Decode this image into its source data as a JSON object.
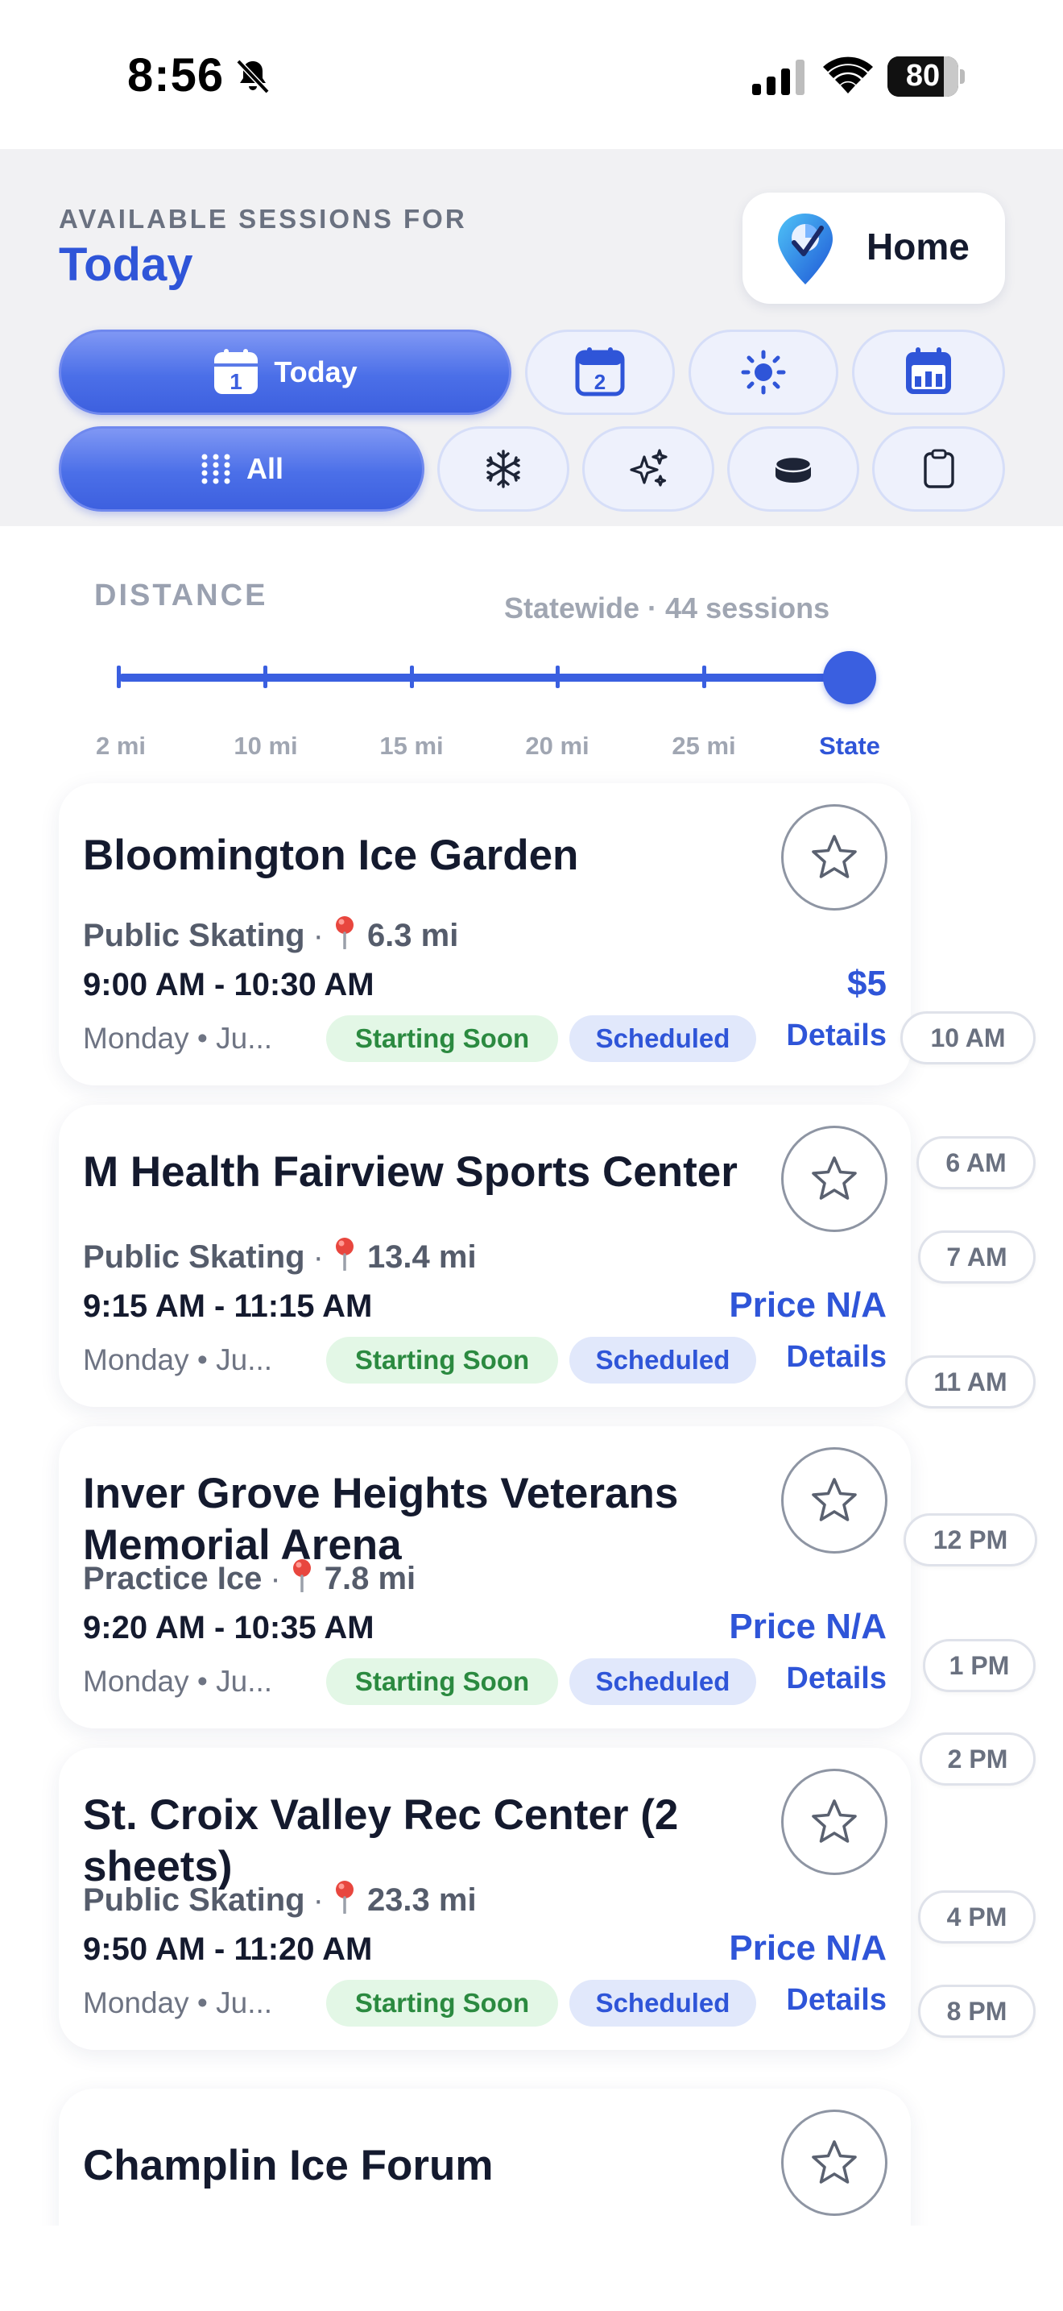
{
  "status_bar": {
    "time": "8:56",
    "battery": "80",
    "battery_level": 0.8
  },
  "header": {
    "label": "AVAILABLE SESSIONS FOR",
    "day": "Today",
    "home_button": "Home",
    "date_pills": {
      "today_label": "Today",
      "calendar_icon_day": "2"
    },
    "type_pills": {
      "all_label": "All"
    }
  },
  "icons": {
    "today": "calendar-today-icon",
    "tomorrow": "calendar-icon",
    "sun": "sun-icon",
    "week": "calendar-week-icon",
    "grid": "grid-icon",
    "snowflake": "snowflake-icon",
    "sparkles": "sparkles-icon",
    "puck": "hockey-puck-icon",
    "clipboard": "clipboard-icon",
    "star": "star-icon",
    "pin": "pin-icon"
  },
  "colors": {
    "accent": "#2f55d8",
    "starting_soon": "#2b8a40",
    "scheduled": "#2f55d8"
  },
  "distance": {
    "label": "DISTANCE",
    "summary": "Statewide · 44 sessions",
    "options": [
      "2 mi",
      "10 mi",
      "15 mi",
      "20 mi",
      "25 mi",
      "State"
    ],
    "selected": "State"
  },
  "sessions": [
    {
      "name": "Bloomington Ice Garden",
      "type": "Public Skating",
      "distance": "6.3 mi",
      "time": "9:00 AM - 10:30 AM",
      "price": "$5",
      "date": "Monday • Ju...",
      "status": "Starting Soon",
      "badge": "Scheduled",
      "details": "Details"
    },
    {
      "name": "M Health Fairview Sports Center",
      "type": "Public Skating",
      "distance": "13.4 mi",
      "time": "9:15 AM - 11:15 AM",
      "price": "Price N/A",
      "date": "Monday • Ju...",
      "status": "Starting Soon",
      "badge": "Scheduled",
      "details": "Details"
    },
    {
      "name": "Inver Grove Heights Veterans Memorial Arena",
      "type": "Practice Ice",
      "distance": "7.8 mi",
      "time": "9:20 AM - 10:35 AM",
      "price": "Price N/A",
      "date": "Monday • Ju...",
      "status": "Starting Soon",
      "badge": "Scheduled",
      "details": "Details"
    },
    {
      "name": "St. Croix Valley Rec Center (2 sheets)",
      "type": "Public Skating",
      "distance": "23.3 mi",
      "time": "9:50 AM - 11:20 AM",
      "price": "Price N/A",
      "date": "Monday • Ju...",
      "status": "Starting Soon",
      "badge": "Scheduled",
      "details": "Details"
    },
    {
      "name": "Champlin Ice Forum"
    }
  ],
  "time_chips": [
    "10 AM",
    "6 AM",
    "7 AM",
    "11 AM",
    "12 PM",
    "1 PM",
    "2 PM",
    "4 PM",
    "8 PM"
  ]
}
